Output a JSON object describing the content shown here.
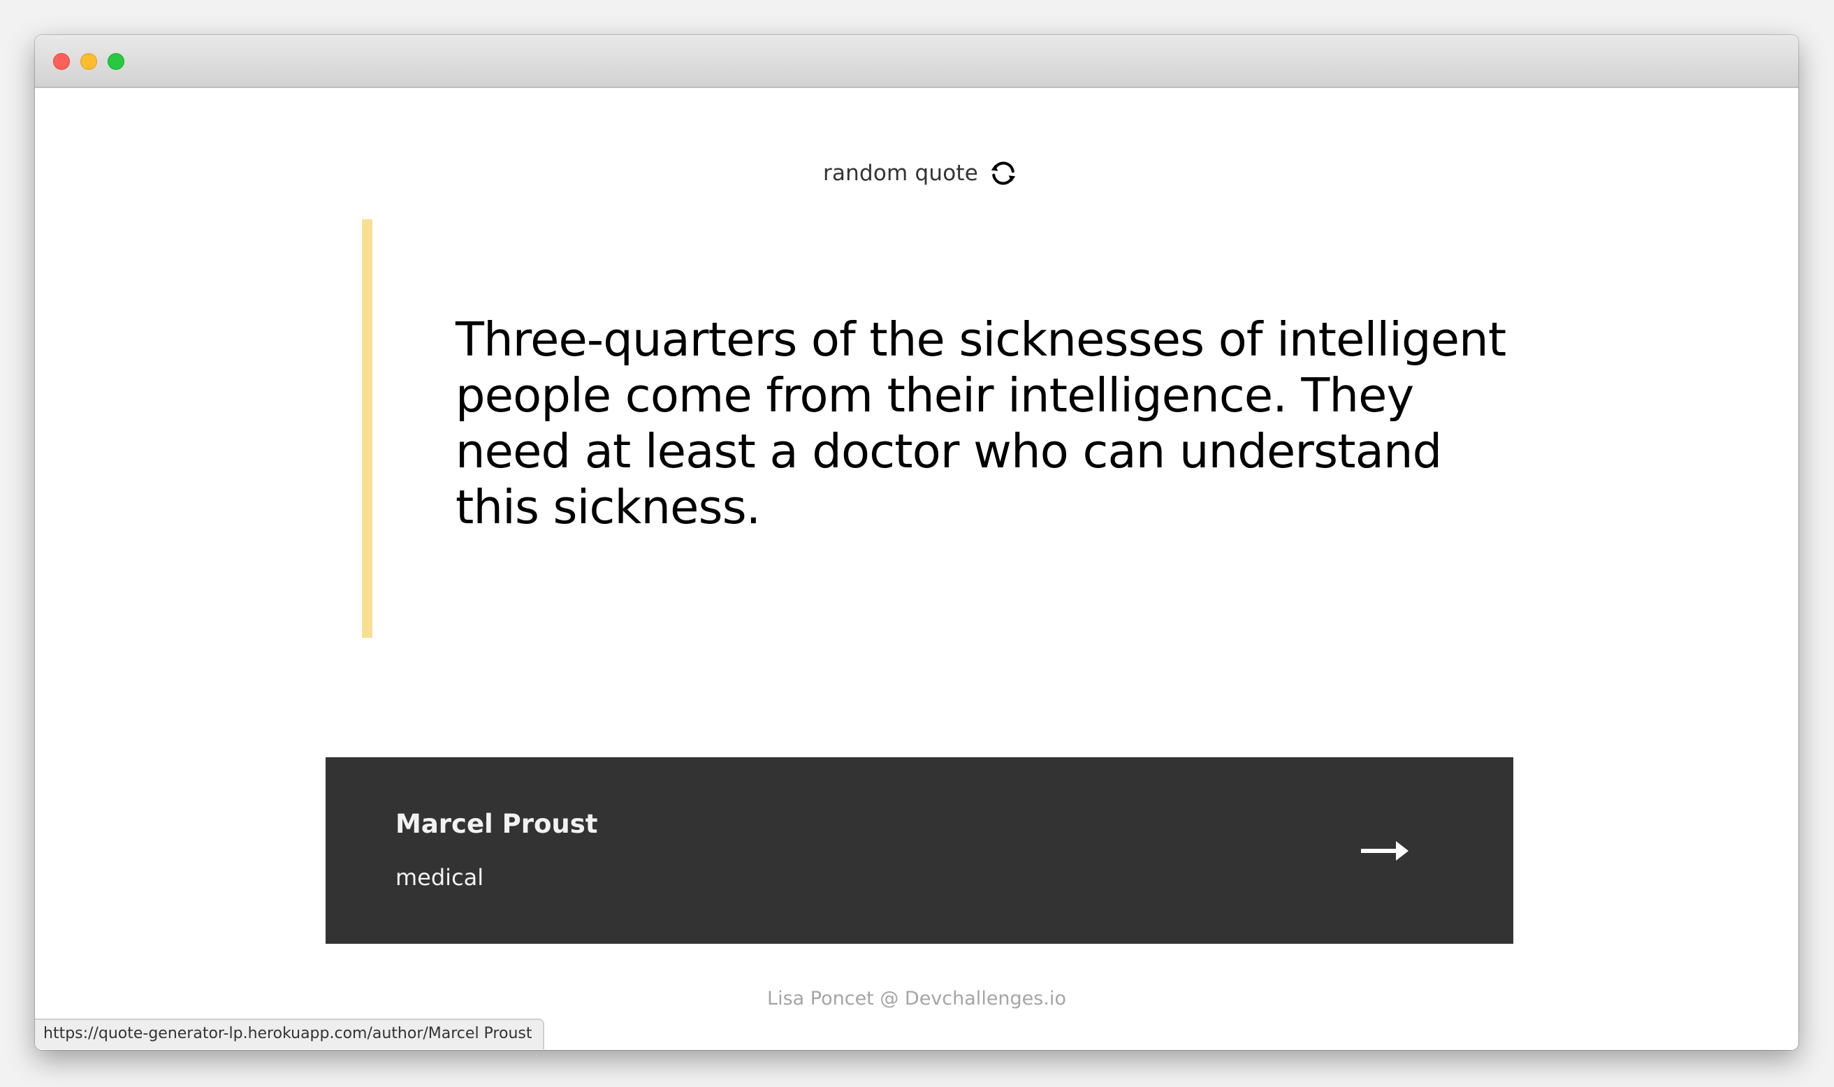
{
  "window": {
    "controls": [
      "close",
      "minimize",
      "zoom"
    ]
  },
  "header": {
    "random_label": "random quote",
    "random_icon": "refresh-icon"
  },
  "quote": {
    "text": "Three-quarters of the sicknesses of intelligent people come from their intelligence. They need at least a doctor who can understand this sickness.",
    "accent_color": "#f7df94"
  },
  "author_card": {
    "name": "Marcel Proust",
    "genre": "medical",
    "icon": "arrow-right-icon",
    "background_color": "#333333"
  },
  "footer": {
    "credit": "Lisa Poncet @ Devchallenges.io"
  },
  "status_bar": {
    "url": "https://quote-generator-lp.herokuapp.com/author/Marcel Proust"
  }
}
